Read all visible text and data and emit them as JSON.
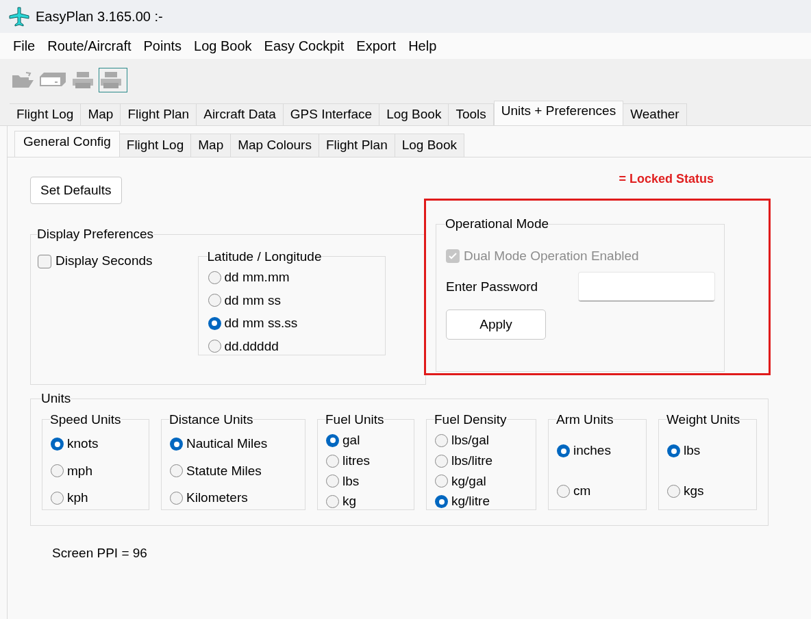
{
  "window": {
    "title": "EasyPlan 3.165.00 :-"
  },
  "menu": [
    "File",
    "Route/Aircraft",
    "Points",
    "Log Book",
    "Easy Cockpit",
    "Export",
    "Help"
  ],
  "tabs": [
    {
      "label": "Flight Log",
      "selected": false
    },
    {
      "label": "Map",
      "selected": false
    },
    {
      "label": "Flight Plan",
      "selected": false
    },
    {
      "label": "Aircraft Data",
      "selected": false
    },
    {
      "label": "GPS Interface",
      "selected": false
    },
    {
      "label": "Log Book",
      "selected": false
    },
    {
      "label": "Tools",
      "selected": false
    },
    {
      "label": "Units + Preferences",
      "selected": true
    },
    {
      "label": "Weather",
      "selected": false
    }
  ],
  "subtabs": [
    {
      "label": "General Config",
      "selected": true
    },
    {
      "label": "Flight Log",
      "selected": false
    },
    {
      "label": "Map",
      "selected": false
    },
    {
      "label": "Map Colours",
      "selected": false
    },
    {
      "label": "Flight Plan",
      "selected": false
    },
    {
      "label": "Log Book",
      "selected": false
    }
  ],
  "set_defaults_button": "Set Defaults",
  "locked_note": "= Locked Status",
  "display_preferences": {
    "title": "Display Preferences",
    "display_seconds": {
      "label": "Display Seconds",
      "checked": false
    },
    "lat_long": {
      "title": "Latitude / Longitude",
      "options": [
        {
          "label": "dd mm.mm",
          "selected": false
        },
        {
          "label": "dd mm ss",
          "selected": false
        },
        {
          "label": "dd mm ss.ss",
          "selected": true
        },
        {
          "label": "dd.ddddd",
          "selected": false
        }
      ]
    }
  },
  "operational_mode": {
    "title": "Operational Mode",
    "dual_mode": {
      "label": "Dual Mode Operation Enabled",
      "checked": true,
      "disabled": true
    },
    "password_label": "Enter Password",
    "apply_button": "Apply"
  },
  "units": {
    "title": "Units",
    "groups": [
      {
        "title": "Speed Units",
        "options": [
          {
            "label": "knots",
            "selected": true
          },
          {
            "label": "mph",
            "selected": false
          },
          {
            "label": "kph",
            "selected": false
          }
        ]
      },
      {
        "title": "Distance Units",
        "options": [
          {
            "label": "Nautical Miles",
            "selected": true
          },
          {
            "label": "Statute Miles",
            "selected": false
          },
          {
            "label": "Kilometers",
            "selected": false
          }
        ]
      },
      {
        "title": "Fuel Units",
        "options": [
          {
            "label": "gal",
            "selected": true
          },
          {
            "label": "litres",
            "selected": false
          },
          {
            "label": "lbs",
            "selected": false
          },
          {
            "label": "kg",
            "selected": false
          }
        ]
      },
      {
        "title": "Fuel Density",
        "options": [
          {
            "label": "lbs/gal",
            "selected": false
          },
          {
            "label": "lbs/litre",
            "selected": false
          },
          {
            "label": "kg/gal",
            "selected": false
          },
          {
            "label": "kg/litre",
            "selected": true
          }
        ]
      },
      {
        "title": "Arm Units",
        "options": [
          {
            "label": "inches",
            "selected": true
          },
          {
            "label": "cm",
            "selected": false
          }
        ]
      },
      {
        "title": "Weight Units",
        "options": [
          {
            "label": "lbs",
            "selected": true
          },
          {
            "label": "kgs",
            "selected": false
          }
        ]
      }
    ]
  },
  "screen_ppi": "Screen PPI = 96"
}
